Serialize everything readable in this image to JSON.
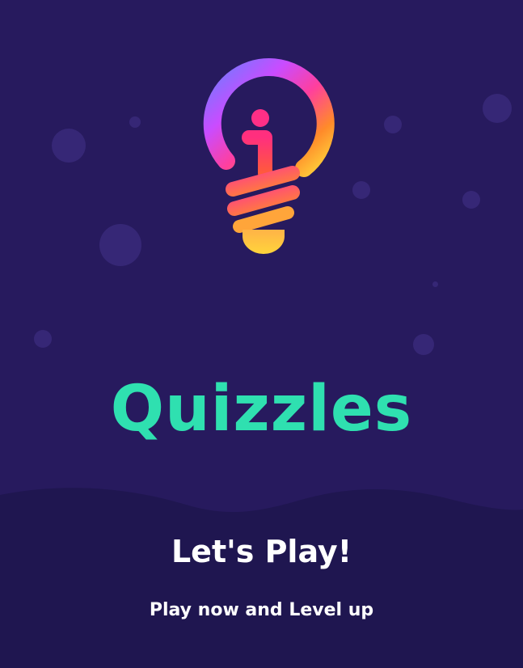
{
  "app": {
    "name": "Quizzles",
    "logo_icon": "lightbulb-i-icon"
  },
  "intro": {
    "headline": "Let's Play!",
    "subtitle": "Play now and Level up"
  },
  "colors": {
    "background": "#271a5e",
    "wave": "#1f1650",
    "bubble": "#3a2a7a",
    "title": "#2fe0b0",
    "text": "#ffffff",
    "logo_gradient": [
      "#7b61ff",
      "#ff3fa4",
      "#ff6a3d",
      "#ffd43b"
    ]
  }
}
